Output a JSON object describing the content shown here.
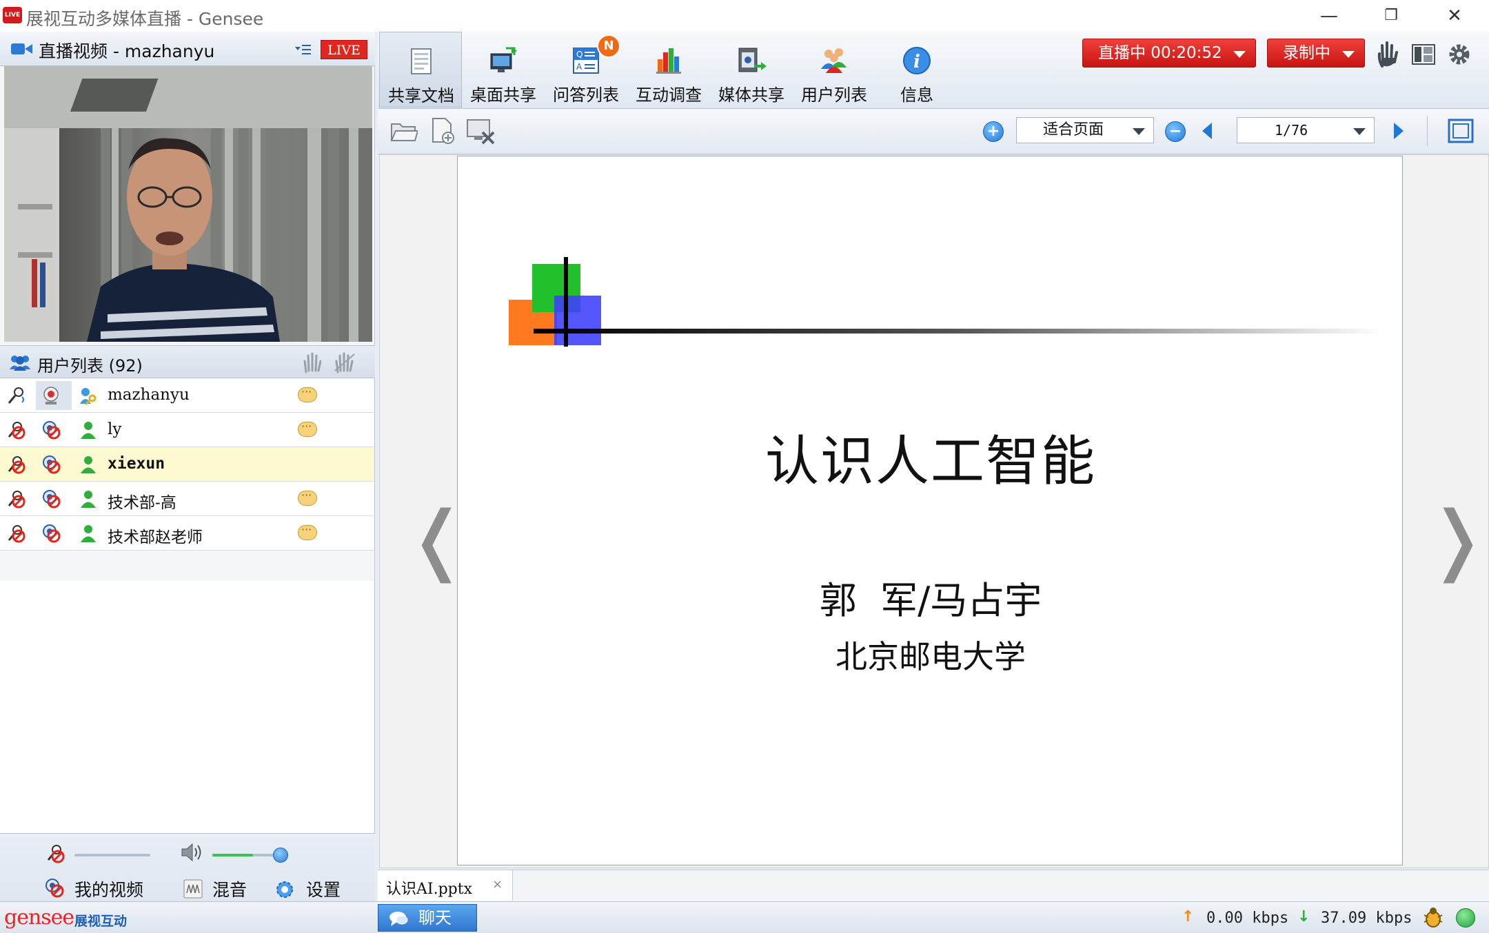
{
  "window": {
    "title": "展视互动多媒体直播 - Gensee",
    "logo_text": "LIVE"
  },
  "video_panel": {
    "label": "直播视频 - mazhanyu",
    "live_badge": "LIVE"
  },
  "user_list": {
    "label": "用户列表 (92)",
    "users": [
      {
        "name": "mazhanyu",
        "role": "presenter",
        "has_chat": true,
        "selected": false,
        "bold": false
      },
      {
        "name": "ly",
        "role": "attendee",
        "has_chat": true,
        "selected": false,
        "bold": false
      },
      {
        "name": "xiexun",
        "role": "attendee",
        "has_chat": false,
        "selected": true,
        "bold": true
      },
      {
        "name": "技术部-高",
        "role": "attendee",
        "has_chat": true,
        "selected": false,
        "bold": false
      },
      {
        "name": "技术部赵老师",
        "role": "attendee",
        "has_chat": true,
        "selected": false,
        "bold": false
      }
    ]
  },
  "left_bottom": {
    "my_video_label": "我的视频",
    "mix_label": "混音",
    "settings_label": "设置",
    "mic_level": 0.0,
    "speaker_level": 0.55
  },
  "brand": {
    "name": "gensee",
    "sub": "展视互动"
  },
  "toolbar": {
    "tools": [
      {
        "label": "共享文档",
        "icon": "document-icon",
        "active": true
      },
      {
        "label": "桌面共享",
        "icon": "desktop-share-icon",
        "active": false
      },
      {
        "label": "问答列表",
        "icon": "qa-list-icon",
        "active": false
      },
      {
        "label": "互动调查",
        "icon": "survey-chart-icon",
        "active": false
      },
      {
        "label": "媒体共享",
        "icon": "media-share-icon",
        "active": false
      },
      {
        "label": "用户列表",
        "icon": "users-icon",
        "active": false
      },
      {
        "label": "信息",
        "icon": "info-icon",
        "active": false
      }
    ],
    "qa_badge": "N",
    "live_status": "直播中 00:20:52",
    "record_status": "录制中"
  },
  "doc_toolbar": {
    "zoom_mode": "适合页面",
    "page": "1/76"
  },
  "slide": {
    "title": "认识人工智能",
    "author": "郭  军/马占宇",
    "org": "北京邮电大学",
    "colors": {
      "green": "#22c02a",
      "orange": "#ff7a1e",
      "blue": "#3e3efc"
    }
  },
  "doc_tab": {
    "name": "认识AI.pptx",
    "close": "×"
  },
  "statusbar": {
    "chat_label": "聊天",
    "upload": "0.00 kbps",
    "download": "37.09 kbps"
  }
}
